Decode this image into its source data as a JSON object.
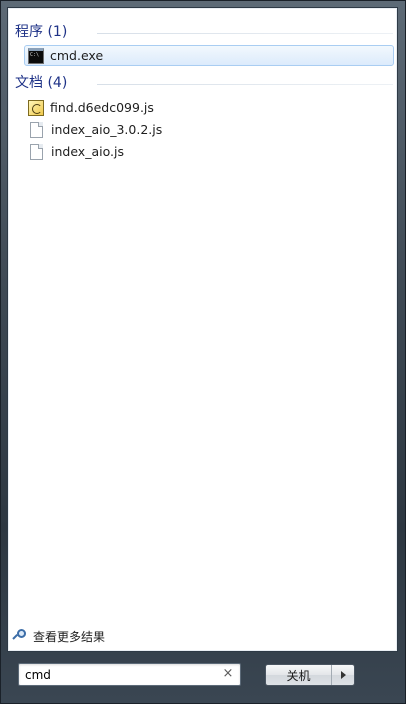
{
  "groups": {
    "programs": {
      "title": "程序 (1)",
      "items": [
        {
          "label": "cmd.exe",
          "icon": "cmd-icon"
        }
      ]
    },
    "documents": {
      "title": "文档 (4)",
      "items": [
        {
          "label": "find.d6edc099.js",
          "icon": "script-file-icon"
        },
        {
          "label": "index_aio_3.0.2.js",
          "icon": "file-icon"
        },
        {
          "label": "index_aio.js",
          "icon": "file-icon"
        }
      ]
    }
  },
  "see_more": {
    "label": "查看更多结果",
    "icon": "search-icon"
  },
  "search": {
    "value": "cmd",
    "clear_glyph": "×"
  },
  "shutdown": {
    "label": "关机",
    "arrow_icon": "triangle-right-icon"
  },
  "colors": {
    "group_header": "#1e3287",
    "selection_fill": "#dcebfc",
    "selection_border": "#a9cdf2"
  }
}
